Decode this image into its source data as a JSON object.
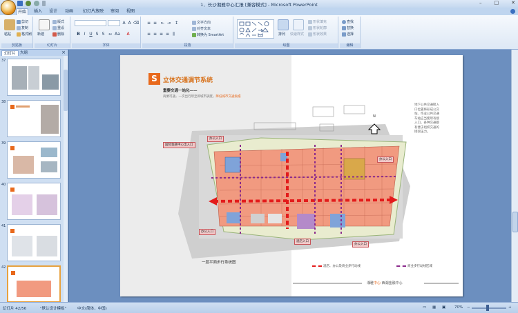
{
  "titlebar": {
    "title": "1．长沙湘雅中心汇报 [兼容模式] - Microsoft PowerPoint",
    "win_controls": [
      "–",
      "□",
      "✕"
    ]
  },
  "ribbon": {
    "tabs": [
      "开始",
      "插入",
      "设计",
      "动画",
      "幻灯片放映",
      "审阅",
      "视图"
    ],
    "active_tab": "开始",
    "groups": {
      "clipboard": {
        "label": "剪贴板",
        "paste": "粘贴",
        "cut": "剪切",
        "copy": "复制",
        "format_painter": "格式刷"
      },
      "slides": {
        "label": "幻灯片",
        "new_slide": "新建\n幻灯片",
        "layout": "版式",
        "reset": "重设",
        "delete": "删除"
      },
      "font": {
        "label": "字体"
      },
      "paragraph": {
        "label": "段落",
        "text_direction": "文字方向",
        "align_text": "对齐文本",
        "smartart": "转换为 SmartArt"
      },
      "drawing": {
        "label": "绘图",
        "arrange": "排列",
        "quick_styles": "快速样式",
        "shape_fill": "形状填充",
        "shape_outline": "形状轮廓",
        "shape_effects": "形状效果"
      },
      "editing": {
        "label": "编辑",
        "find": "查找",
        "replace": "替换",
        "select": "选择"
      }
    }
  },
  "leftpanel": {
    "tabs": [
      "幻灯片",
      "大纲"
    ],
    "close": "×",
    "thumbnails": [
      {
        "num": "37"
      },
      {
        "num": "38"
      },
      {
        "num": "39"
      },
      {
        "num": "40"
      },
      {
        "num": "41"
      },
      {
        "num": "42",
        "selected": true
      }
    ]
  },
  "slide": {
    "logo": "S",
    "title": "立体交通调节系统",
    "subtitle": "重要交通一站化——",
    "description": "商業可通，一次出行所至即城市調度，",
    "description_highlight": "降低城市交通負擔",
    "right_note": "地下公共交通接入口位置将形成公交站、作业公共交通车站应当使所有接入口。各种交通都有便于组织交通的接驳压力。",
    "labels": {
      "top_left": "国际金融中心出入口",
      "top_mid": "办公入口",
      "top_right": "办公入口",
      "bottom_left": "办公入口",
      "bottom_mid": "酒店入口",
      "bottom_right": "办公入口",
      "north": "N"
    },
    "caption": "一层平面步行系统图",
    "legend_1": "酒店、办公及商业步行动线",
    "legend_2": "商业步行动线区域",
    "footer": "湘雅",
    "footer_highlight": "中心",
    "footer_rest": "·西湖金融中心"
  },
  "statusbar": {
    "slide_info": "幻灯片 42/56",
    "theme": "\"默认设计模板\"",
    "language": "中文(简体，中国)",
    "zoom": "70%"
  },
  "colors": {
    "accent_orange": "#e8691c",
    "ribbon_blue": "#bfd5ef",
    "canvas_blue": "#6c8fbf",
    "plan_salmon": "#f19a80",
    "plan_path": "#e31b1b",
    "plan_purple": "#8b2a8c"
  }
}
